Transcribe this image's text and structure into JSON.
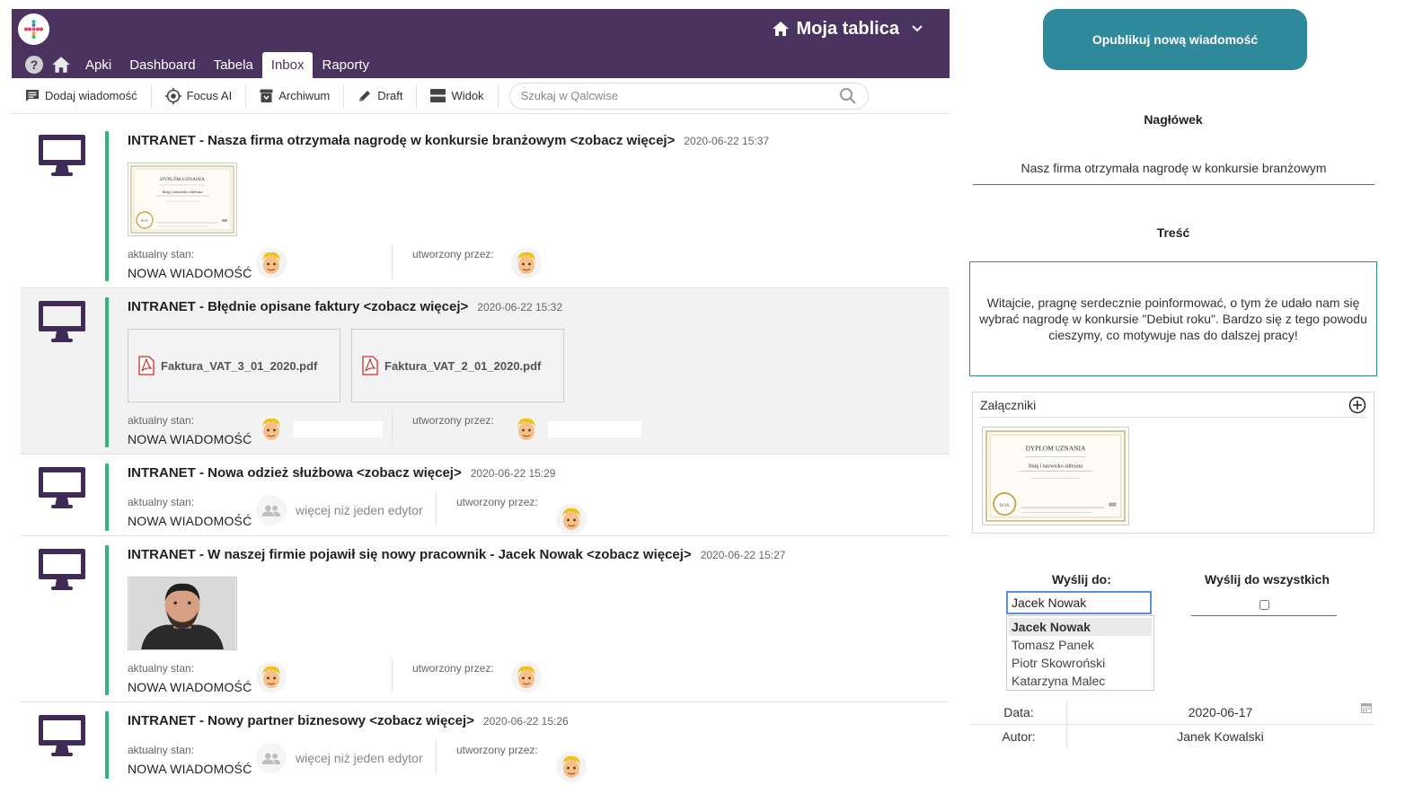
{
  "header": {
    "board_title": "Moja tablica",
    "tabs": [
      {
        "label": "Apki"
      },
      {
        "label": "Dashboard"
      },
      {
        "label": "Tabela"
      },
      {
        "label": "Inbox",
        "active": true
      },
      {
        "label": "Raporty"
      }
    ]
  },
  "toolbar": {
    "add_message": "Dodaj wiadomość",
    "focus_ai": "Focus AI",
    "archive": "Archiwum",
    "draft": "Draft",
    "view": "Widok",
    "search_placeholder": "Szukaj w Qalcwise"
  },
  "feed": {
    "status_label": "aktualny stan:",
    "created_label": "utworzony przez:",
    "multi_editor": "więcej niż jeden edytor",
    "messages": [
      {
        "title": "INTRANET - Nasza firma otrzymała nagrodę w konkursie branżowym <zobacz więcej>",
        "date": "2020-06-22 15:37",
        "status": "NOWA WIADOMOŚĆ"
      },
      {
        "title": "INTRANET - Błędnie opisane faktury <zobacz więcej>",
        "date": "2020-06-22 15:32",
        "status": "NOWA WIADOMOŚĆ",
        "files": [
          "Faktura_VAT_3_01_2020.pdf",
          "Faktura_VAT_2_01_2020.pdf"
        ]
      },
      {
        "title": "INTRANET - Nowa odzież służbowa <zobacz więcej>",
        "date": "2020-06-22 15:29",
        "status": "NOWA WIADOMOŚĆ"
      },
      {
        "title": "INTRANET - W naszej firmie pojawił się nowy pracownik - Jacek Nowak <zobacz więcej>",
        "date": "2020-06-22 15:27",
        "status": "NOWA WIADOMOŚĆ"
      },
      {
        "title": "INTRANET - Nowy partner biznesowy <zobacz więcej>",
        "date": "2020-06-22 15:26",
        "status": "NOWA WIADOMOŚĆ"
      }
    ]
  },
  "thumbnail": {
    "title": "DYPLOM UZNANIA",
    "name_line": "Imię i nazwisko adresata",
    "seal": "BOK"
  },
  "form": {
    "publish_button": "Opublikuj nową wiadomość",
    "heading_label": "Nagłówek",
    "heading_value": "Nasz firma otrzymała nagrodę w konkursie branżowym",
    "body_label": "Treść",
    "body_value": "Witajcie, pragnę serdecznie poinformować, o tym że udało nam się wybrać nagrodę w konkursie \"Debiut roku\". Bardzo się z tego powodu cieszymy, co motywuje nas do dalszej pracy!",
    "attachments_label": "Załączniki",
    "send_to_label": "Wyślij do:",
    "send_to_value": "Jacek Nowak",
    "send_to_options": [
      "Jacek Nowak",
      "Tomasz Panek",
      "Piotr Skowroński",
      "Katarzyna Malec"
    ],
    "send_all_label": "Wyślij do wszystkich",
    "date_label": "Data:",
    "date_value": "2020-06-17",
    "author_label": "Autor:",
    "author_value": "Janek Kowalski"
  },
  "colors": {
    "topbar": "#4a335f",
    "accent_green": "#2fb47c",
    "teal": "#2e8a9a",
    "monitor": "#3f2b56"
  }
}
